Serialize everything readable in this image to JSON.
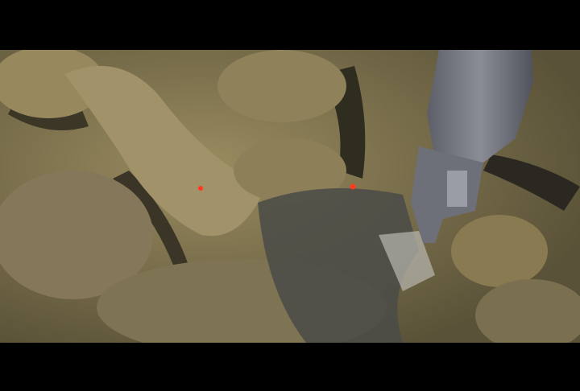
{
  "scene": {
    "colors": {
      "letterbox": "#000000",
      "rock": "#8a7d55",
      "rock_light": "#a89868",
      "shadow": "#2e2c22",
      "manipulator": "#7a7c86",
      "laser": "#ff3a20"
    },
    "laser_dots": 2
  }
}
